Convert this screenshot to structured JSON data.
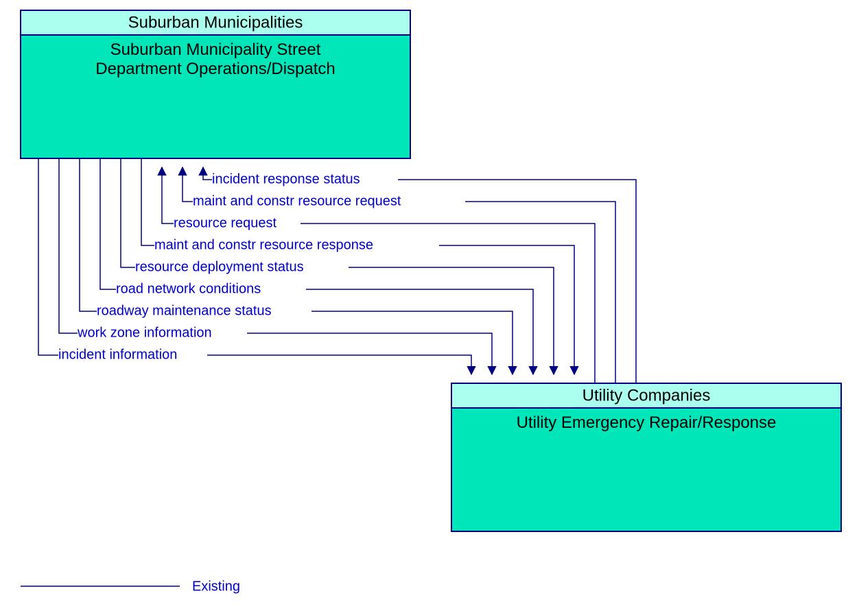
{
  "boxA": {
    "header": "Suburban Municipalities",
    "body_line1": "Suburban Municipality Street",
    "body_line2": "Department Operations/Dispatch"
  },
  "boxB": {
    "header": "Utility Companies",
    "body_line1": "Utility Emergency Repair/Response"
  },
  "flows": {
    "f0": "incident response status",
    "f1": "maint and constr resource request",
    "f2": "resource request",
    "f3": "maint and constr resource response",
    "f4": "resource deployment status",
    "f5": "road network conditions",
    "f6": "roadway maintenance status",
    "f7": "work zone information",
    "f8": "incident information"
  },
  "legend": {
    "label": "Existing"
  }
}
